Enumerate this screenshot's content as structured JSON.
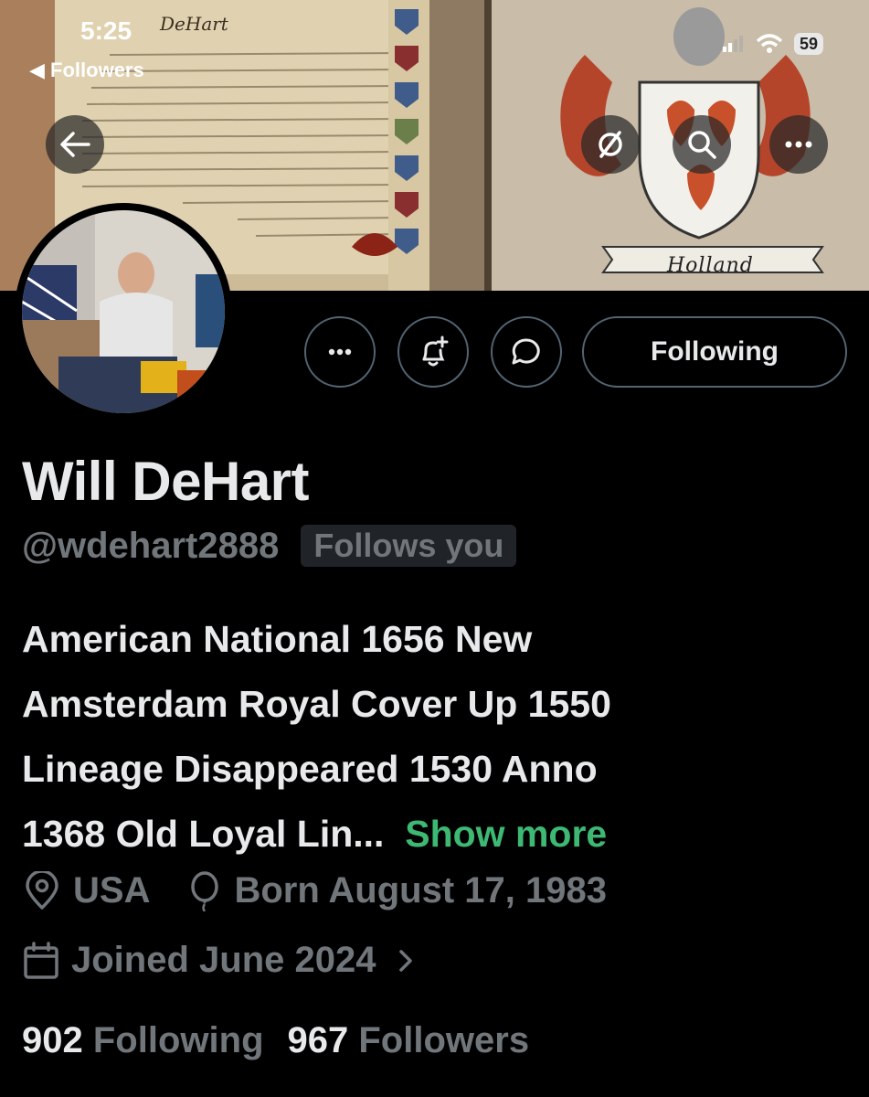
{
  "status_bar": {
    "time": "5:25",
    "back_label": "Followers",
    "battery": "59"
  },
  "banner": {
    "scroll_title": "DeHart",
    "crest_label": "Holland"
  },
  "profile": {
    "name": "Will DeHart",
    "handle": "@wdehart2888",
    "follows_you_badge": "Follows you",
    "bio_lines": [
      "American National 1656 New",
      "Amsterdam Royal Cover Up 1550",
      "Lineage Disappeared 1530 Anno",
      "1368 Old Loyal Lin..."
    ],
    "show_more_label": "Show more",
    "location": "USA",
    "birthday": "Born August 17, 1983",
    "joined": "Joined June 2024",
    "following_count": "902",
    "following_label": "Following",
    "followers_count": "967",
    "followers_label": "Followers"
  },
  "actions": {
    "follow_button_label": "Following"
  },
  "icons": {
    "back": "arrow-left-icon",
    "mute": "mute-icon",
    "search": "search-icon",
    "more": "more-icon",
    "notify": "bell-plus-icon",
    "message": "message-bubble-icon",
    "location": "location-pin-icon",
    "birthday": "balloon-icon",
    "joined": "calendar-icon"
  },
  "colors": {
    "background": "#000000",
    "text": "#e7e9ea",
    "muted": "#71767b",
    "accent_green": "#3db974",
    "border": "#536471"
  }
}
